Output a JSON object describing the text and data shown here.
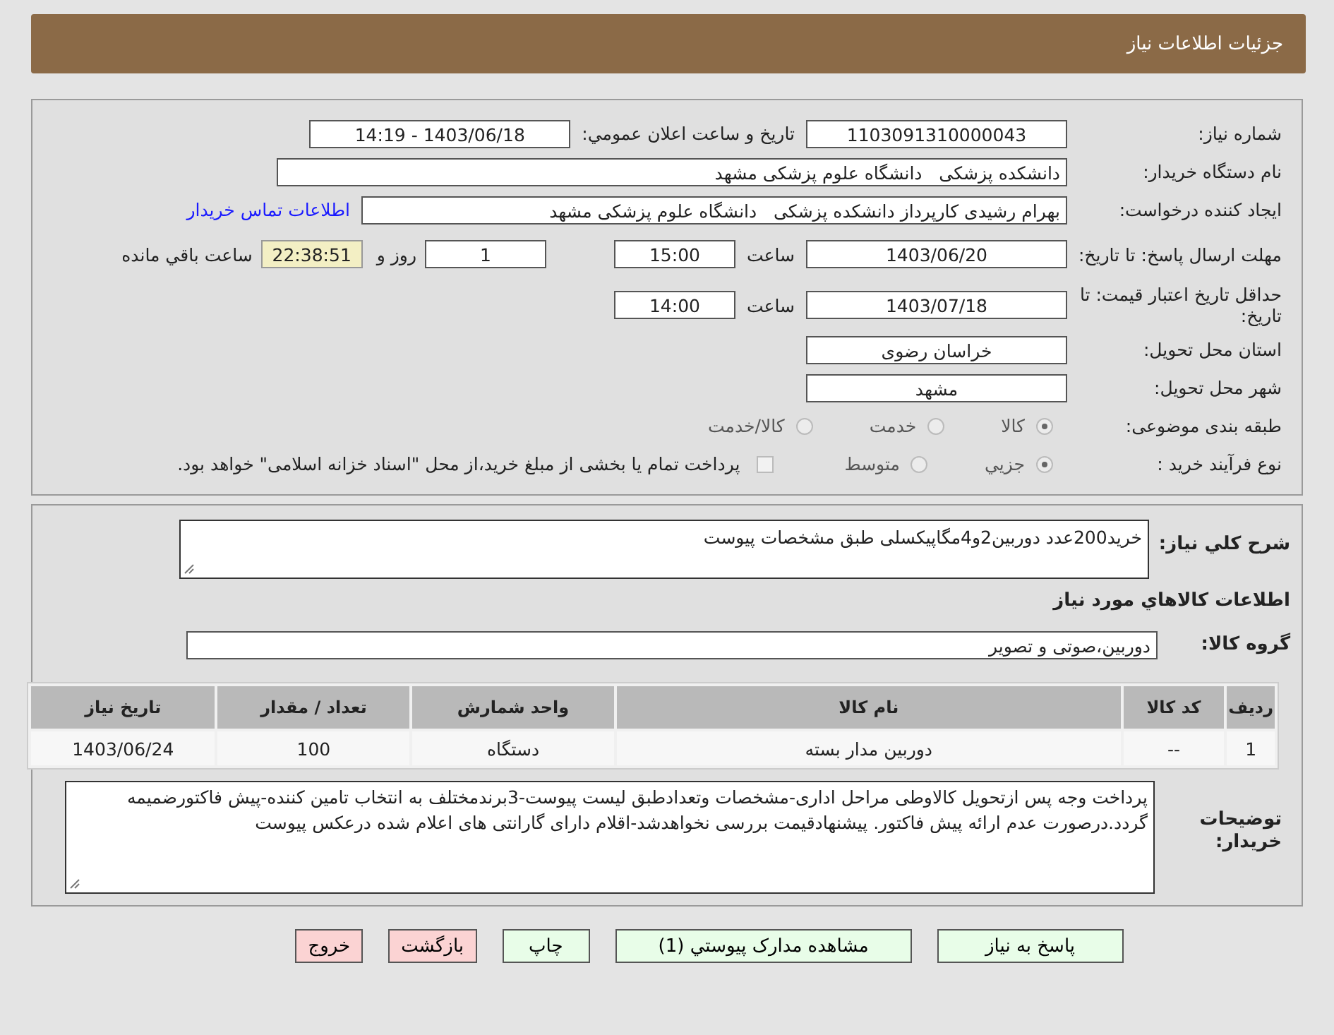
{
  "header": {
    "title": "جزئیات اطلاعات نیاز"
  },
  "details": {
    "need_number": {
      "label": "شماره نیاز:",
      "value": "1103091310000043"
    },
    "announce": {
      "label": "تاریخ و ساعت اعلان عمومي:",
      "value": "1403/06/18 - 14:19"
    },
    "buyer": {
      "label": "نام دستگاه خریدار:",
      "value": "دانشکده پزشکی   دانشگاه علوم پزشکی مشهد"
    },
    "requester": {
      "label": "ایجاد کننده درخواست:",
      "value": "بهرام رشیدی کارپرداز دانشکده پزشکی   دانشگاه علوم پزشکی مشهد",
      "link": "اطلاعات تماس خریدار"
    },
    "deadline": {
      "label": "مهلت ارسال پاسخ: تا تاریخ:",
      "date": "1403/06/20",
      "time_label": "ساعت",
      "time": "15:00",
      "days": "1",
      "days_label": "روز و",
      "remaining": "22:38:51",
      "remaining_label": "ساعت باقي مانده"
    },
    "validity": {
      "label": "حداقل تاریخ اعتبار قیمت: تا تاریخ:",
      "date": "1403/07/18",
      "time_label": "ساعت",
      "time": "14:00"
    },
    "province": {
      "label": "استان محل تحویل:",
      "value": "خراسان رضوی"
    },
    "city": {
      "label": "شهر محل تحویل:",
      "value": "مشهد"
    },
    "category": {
      "label": "طبقه بندی موضوعی:",
      "disabled": true,
      "options": [
        {
          "label": "کالا",
          "selected": true
        },
        {
          "label": "خدمت",
          "selected": false
        },
        {
          "label": "کالا/خدمت",
          "selected": false
        }
      ]
    },
    "process": {
      "label": "نوع فرآیند خرید :",
      "disabled": true,
      "options": [
        {
          "label": "جزيي",
          "selected": true
        },
        {
          "label": "متوسط",
          "selected": false
        }
      ],
      "treasury": {
        "label": "پرداخت تمام یا بخشی از مبلغ خرید،از محل \"اسناد خزانه اسلامی\" خواهد بود.",
        "checked": false
      }
    }
  },
  "need": {
    "summary_label": "شرح کلي نیاز:",
    "summary": "خرید200عدد دوربین2و4مگاپیکسلی طبق مشخصات پیوست",
    "goods_heading": "اطلاعات کالاهاي مورد نیاز",
    "group_label": "گروه کالا:",
    "group": "دوربین،صوتی و تصویر"
  },
  "table": {
    "columns": [
      "ردیف",
      "کد کالا",
      "نام کالا",
      "واحد شمارش",
      "تعداد / مقدار",
      "تاریخ نیاز"
    ],
    "rows": [
      [
        "1",
        "--",
        "دوربین مدار بسته",
        "دستگاه",
        "100",
        "1403/06/24"
      ]
    ]
  },
  "notes": {
    "label": "توضیحات خریدار:",
    "text": "پرداخت وجه پس ازتحویل کالاوطی مراحل اداری-مشخصات وتعدادطبق لیست پیوست-3برندمختلف به انتخاب تامین کننده-پیش فاکتورضمیمه گردد.درصورت عدم ارائه پیش فاکتور. پیشنهادقیمت بررسی نخواهدشد-اقلام دارای گارانتی های اعلام شده درعکس پیوست"
  },
  "buttons": [
    {
      "label": "پاسخ به نیاز",
      "kind": "action"
    },
    {
      "label": "مشاهده مدارک پیوستي (1)",
      "kind": "action"
    },
    {
      "label": "چاپ",
      "kind": "action"
    },
    {
      "label": "بازگشت",
      "kind": "exit"
    },
    {
      "label": "خروج",
      "kind": "exit"
    }
  ]
}
